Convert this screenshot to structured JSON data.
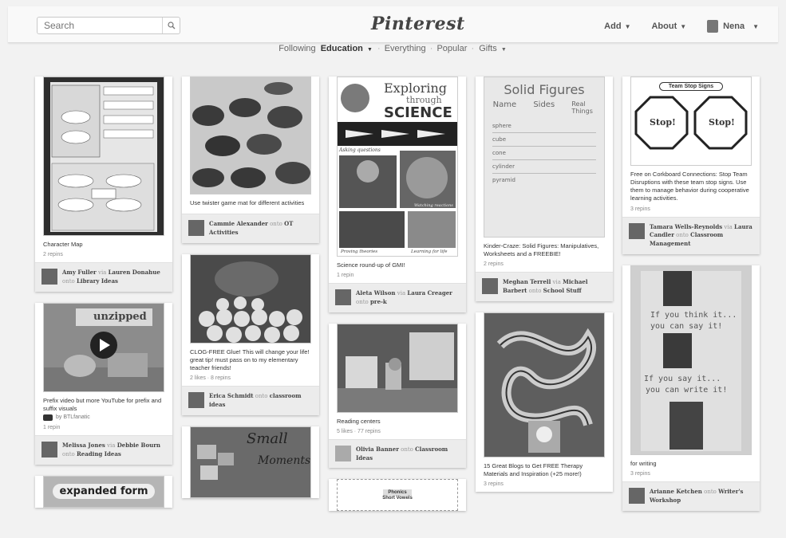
{
  "header": {
    "search_placeholder": "Search",
    "logo": "Pinterest",
    "add": "Add",
    "about": "About",
    "user": "Nena"
  },
  "subnav": {
    "following": "Following",
    "education": "Education",
    "everything": "Everything",
    "popular": "Popular",
    "gifts": "Gifts"
  },
  "pins": {
    "p1": {
      "desc": "Character Map",
      "stats": "2 repins",
      "user": "Amy Fuller",
      "via": "via",
      "via_user": "Lauren Donahue",
      "onto": "onto",
      "board": "Library Ideas"
    },
    "p2": {
      "desc": "Prefix video but more YouTube for prefix and suffix visuals",
      "by": "by BTLfanatic",
      "stats": "1 repin",
      "user": "Melissa Jones",
      "via": "via",
      "via_user": "Debbie Bourn",
      "onto": "onto",
      "board": "Reading Ideas",
      "video_text": "unzipped"
    },
    "p3": {
      "desc": "Use twister game mat for different activities",
      "user": "Cammie Alexander",
      "onto": "onto",
      "board": "OT Activities"
    },
    "p4": {
      "desc": "CLOG-FREE Glue! This will change your life! great tip! must pass on to my elementary teacher friends!",
      "stats": "2 likes · 8 repins",
      "user": "Erica Schmidt",
      "onto": "onto",
      "board": "classroom ideas"
    },
    "p5": {
      "img_title_1": "Exploring",
      "img_title_2": "through",
      "img_title_3": "SCIENCE",
      "img_caption_1": "Asking questions",
      "img_caption_2": "Watching reactions",
      "img_caption_3": "Learning for life",
      "img_caption_4": "Proving theories",
      "desc": "Science round-up of GMI!",
      "stats": "1 repin",
      "user": "Aleta Wilson",
      "via": "via",
      "via_user": "Laura Creager",
      "onto": "onto",
      "board": "pre-k"
    },
    "p6": {
      "desc": "Reading centers",
      "stats": "5 likes · 77 repins",
      "user": "Olivia Banner",
      "onto": "onto",
      "board": "Classroom Ideas"
    },
    "p7": {
      "img_title": "Solid Figures",
      "img_h1": "Name",
      "img_h2": "Sides",
      "img_h3": "Real Things",
      "img_r1": "sphere",
      "img_r2": "cube",
      "img_r3": "cone",
      "img_r4": "cylinder",
      "img_r5": "pyramid",
      "desc": "Kinder-Craze: Solid Figures: Manipulatives, Worksheets and a FREEBIE!",
      "stats": "2 repins",
      "user": "Meghan Terrell",
      "via": "via",
      "via_user": "Michael Barbert",
      "onto": "onto",
      "board": "School Stuff"
    },
    "p8": {
      "desc": "15 Great Blogs to Get FREE Therapy Materials and Inspiration (+25 more!)",
      "stats": "3 repins"
    },
    "p9": {
      "img_title": "Team Stop Signs",
      "stop": "Stop!",
      "desc": "Free on Corkboard Connections: Stop Team Disruptions with these team stop signs. Use them to manage behavior during cooperative learning activities.",
      "stats": "3 repins",
      "user": "Tamara Wells-Reynolds",
      "via": "via",
      "via_user": "Laura Candler",
      "onto": "onto",
      "board": "Classroom Management"
    },
    "p10": {
      "img_l1": "If you think it...",
      "img_l2": "you can say it!",
      "img_l3": "If you say it...",
      "img_l4": "you can write it!",
      "desc": "for writing",
      "stats": "3 repins",
      "user": "Arianne Ketchen",
      "onto": "onto",
      "board": "Writer's Workshop"
    },
    "p11": {
      "img_text": "expanded form"
    },
    "p12": {
      "img_text_1": "Small",
      "img_text_2": "Moments"
    },
    "p13": {
      "img_text_1": "Phonics",
      "img_text_2": "Short Vowels"
    }
  }
}
